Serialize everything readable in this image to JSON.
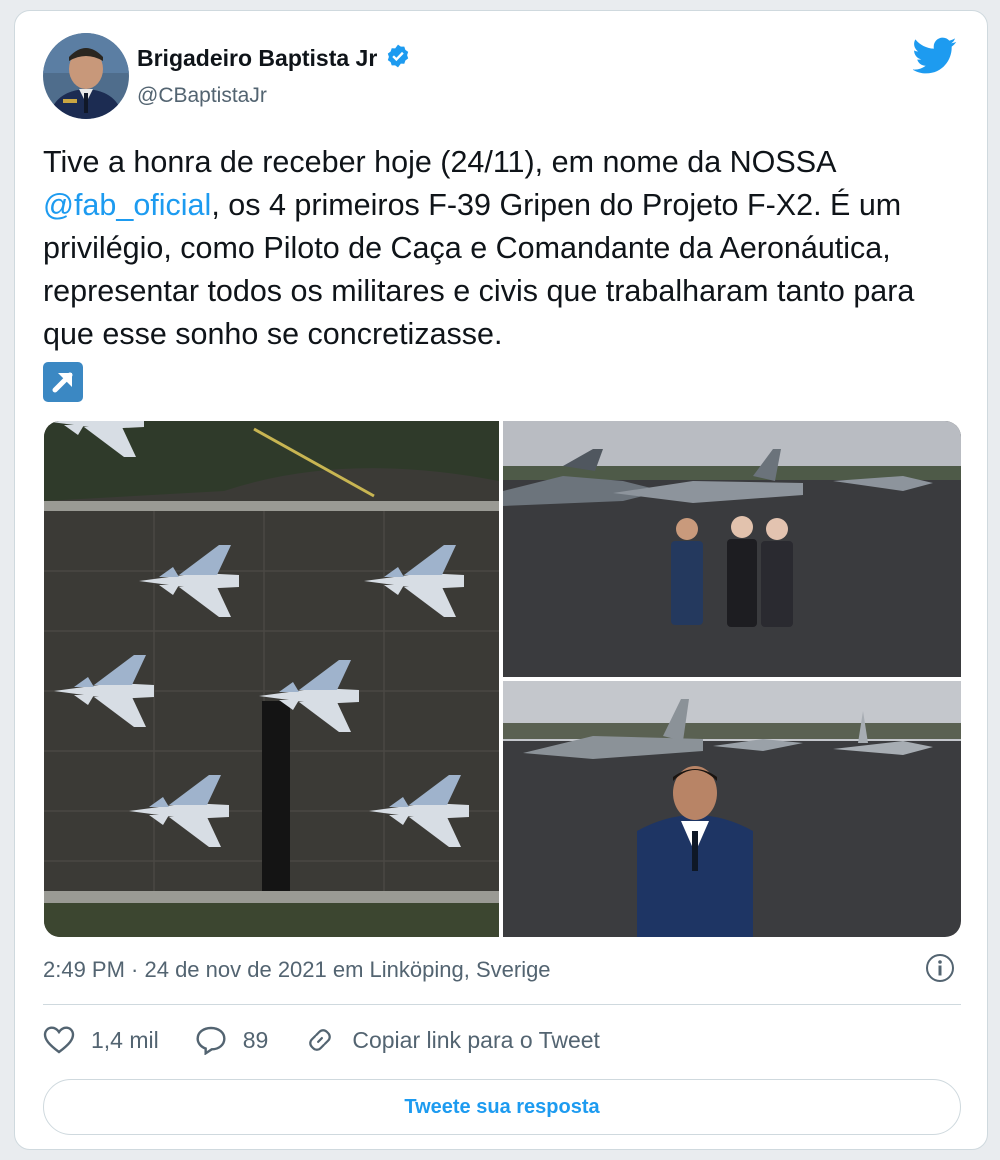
{
  "author": {
    "name": "Brigadeiro Baptista Jr",
    "handle": "@CBaptistaJr"
  },
  "tweet": {
    "text_1": "Tive a honra de receber hoje (24/11), em nome da NOSSA",
    "mention": "@fab_oficial",
    "text_2": ", os 4 primeiros F-39 Gripen do Projeto F-X2. É um privilégio, como Piloto de Caça e Comandante da Aeronáutica, representar todos os militares e civis que trabalharam tanto para que esse sonho se concretizasse."
  },
  "meta": {
    "timestamp": "2:49 PM · 24 de nov de 2021 em Linköping, Sverige"
  },
  "actions": {
    "likes": "1,4 mil",
    "replies": "89",
    "copy_link": "Copiar link para o Tweet"
  },
  "reply_button": "Tweete sua resposta",
  "icons": [
    "verified-badge-icon",
    "twitter-bird-icon",
    "external-link-icon",
    "info-icon",
    "heart-icon",
    "reply-icon",
    "link-icon"
  ],
  "colors": {
    "accent": "#1d9bf0",
    "text": "#0f1419",
    "muted": "#536471"
  }
}
